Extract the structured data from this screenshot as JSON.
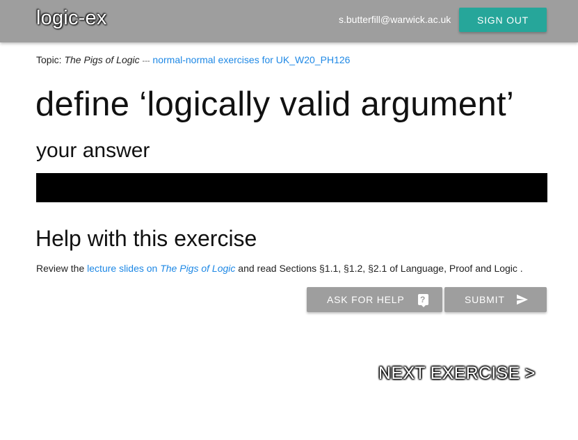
{
  "navbar": {
    "brand": "logic-ex",
    "user_email": "s.butterfill@warwick.ac.uk",
    "signout_label": "SIGN OUT",
    "background_color": "#9e9e9e",
    "signout_color": "#26a69a"
  },
  "topic": {
    "prefix": "Topic:",
    "book_title": "The Pigs of Logic",
    "separator": "---",
    "exercise_set_link": "normal-normal exercises for UK_W20_PH126"
  },
  "exercise": {
    "title": "define ‘logically valid argument’"
  },
  "answer": {
    "heading": "your answer",
    "value": ""
  },
  "help": {
    "heading": "Help with this exercise",
    "text_before": "Review the",
    "link_text": "lecture slides on",
    "link_book": "The Pigs of Logic",
    "text_after": "and read Sections §1.1, §1.2, §2.1 of Language, Proof and Logic ."
  },
  "actions": {
    "ask_for_help_label": "ASK FOR HELP",
    "ask_for_help_icon": "live-help-icon",
    "submit_label": "SUBMIT",
    "submit_icon": "send-icon"
  },
  "next": {
    "label": "NEXT EXERCISE >"
  }
}
